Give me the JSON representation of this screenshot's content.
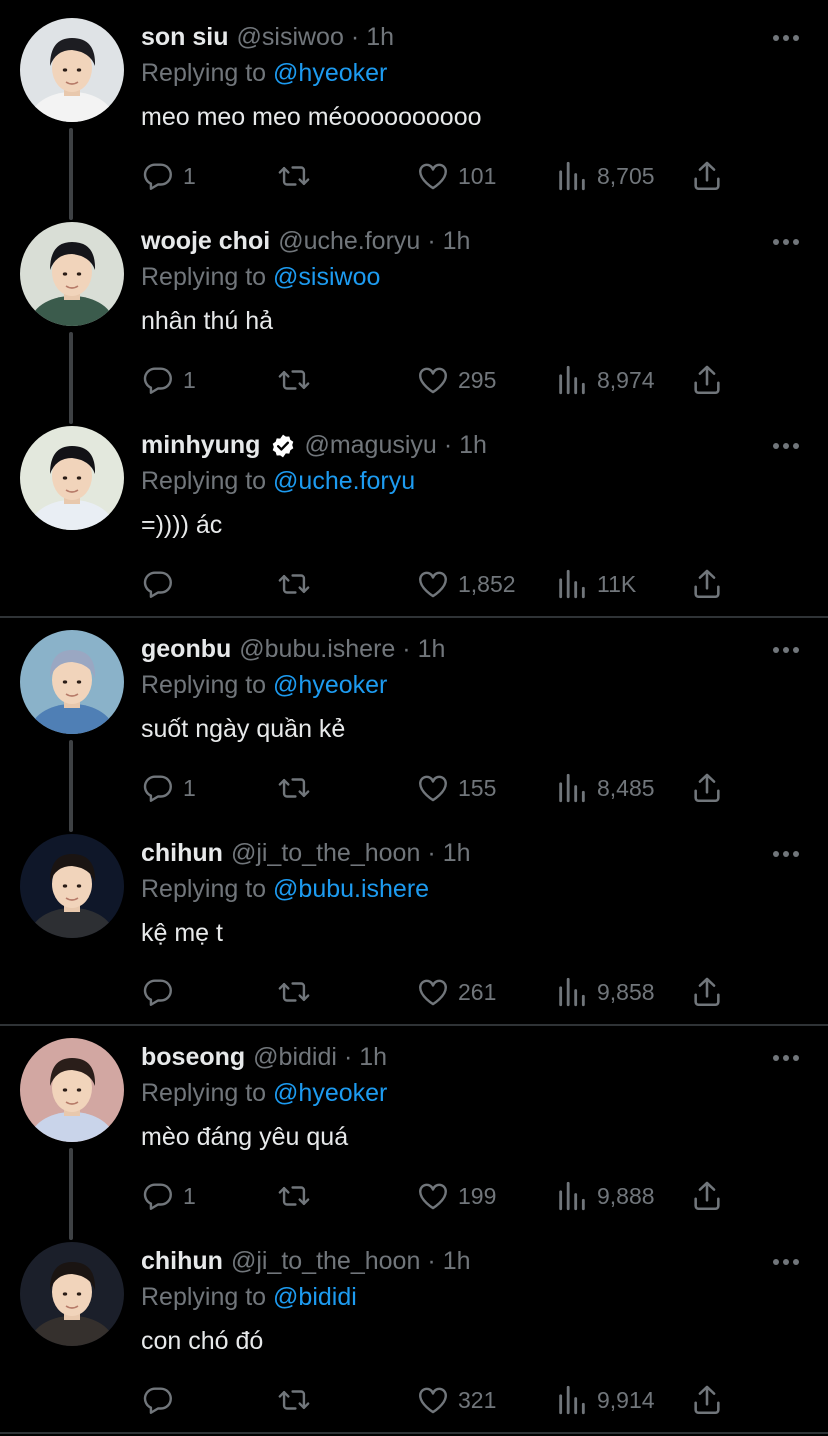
{
  "replying_prefix": "Replying to",
  "colors": {
    "background": "#000000",
    "text": "#e7e9ea",
    "muted": "#71767b",
    "mention": "#1d9bf0",
    "divider": "#2f3336",
    "verified": "#ffffff"
  },
  "icons": {
    "reply": "speech-bubble-icon",
    "retweet": "retweet-arrows-icon",
    "like": "heart-icon",
    "views": "bar-chart-icon",
    "share": "share-upload-icon",
    "more": "ellipsis-icon",
    "verified": "verified-badge-icon"
  },
  "tweets": [
    {
      "name": "son siu",
      "handle": "@sisiwoo",
      "dot": "·",
      "time": "1h",
      "replying_to": "@hyeoker",
      "text": "meo meo meo méoooooooooo",
      "replies": "1",
      "retweets": "",
      "likes": "101",
      "views": "8,705",
      "verified": false
    },
    {
      "name": "wooje choi",
      "handle": "@uche.foryu",
      "dot": "·",
      "time": "1h",
      "replying_to": "@sisiwoo",
      "text": "nhân thú hả",
      "replies": "1",
      "retweets": "",
      "likes": "295",
      "views": "8,974",
      "verified": false
    },
    {
      "name": "minhyung",
      "handle": "@magusiyu",
      "dot": "·",
      "time": "1h",
      "replying_to": "@uche.foryu",
      "text": "=)))) ác",
      "replies": "",
      "retweets": "",
      "likes": "1,852",
      "views": "11K",
      "verified": true
    },
    {
      "name": "geonbu",
      "handle": "@bubu.ishere",
      "dot": "·",
      "time": "1h",
      "replying_to": "@hyeoker",
      "text": "suốt ngày quần kẻ",
      "replies": "1",
      "retweets": "",
      "likes": "155",
      "views": "8,485",
      "verified": false
    },
    {
      "name": "chihun",
      "handle": "@ji_to_the_hoon",
      "dot": "·",
      "time": "1h",
      "replying_to": "@bubu.ishere",
      "text": "kệ mẹ t",
      "replies": "",
      "retweets": "",
      "likes": "261",
      "views": "9,858",
      "verified": false
    },
    {
      "name": "boseong",
      "handle": "@bididi",
      "dot": "·",
      "time": "1h",
      "replying_to": "@hyeoker",
      "text": "mèo đáng yêu quá",
      "replies": "1",
      "retweets": "",
      "likes": "199",
      "views": "9,888",
      "verified": false
    },
    {
      "name": "chihun",
      "handle": "@ji_to_the_hoon",
      "dot": "·",
      "time": "1h",
      "replying_to": "@bididi",
      "text": "con chó đó",
      "replies": "",
      "retweets": "",
      "likes": "321",
      "views": "9,914",
      "verified": false
    }
  ]
}
